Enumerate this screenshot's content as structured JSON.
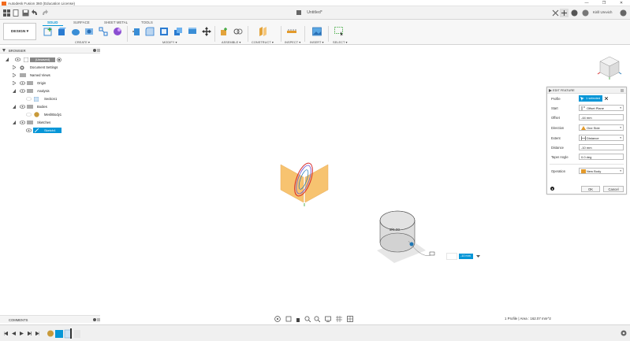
{
  "window": {
    "title": "Autodesk Fusion 360 (Education License)",
    "minimize": "—",
    "maximize": "❐",
    "close": "✕"
  },
  "appbar": {
    "document_title": "Untitled*",
    "user": "Kirill Urevich"
  },
  "toolbar": {
    "workspace": "DESIGN ▾",
    "tabs": [
      "SOLID",
      "SURFACE",
      "SHEET METAL",
      "TOOLS"
    ],
    "groups": [
      "CREATE ▾",
      "MODIFY ▾",
      "ASSEMBLE ▾",
      "CONSTRUCT ▾",
      "INSPECT ▾",
      "INSERT ▾",
      "SELECT ▾"
    ]
  },
  "browser": {
    "title": "BROWSER",
    "items": [
      {
        "label": "(Unsaved)",
        "depth": 0
      },
      {
        "label": "Document Settings",
        "depth": 1
      },
      {
        "label": "Named Views",
        "depth": 1
      },
      {
        "label": "Origin",
        "depth": 1
      },
      {
        "label": "Analysis",
        "depth": 1
      },
      {
        "label": "Section1",
        "depth": 2
      },
      {
        "label": "Bodies",
        "depth": 1
      },
      {
        "label": "MeshBody1",
        "depth": 2
      },
      {
        "label": "Sketches",
        "depth": 1
      },
      {
        "label": "Sketch4",
        "depth": 2
      }
    ]
  },
  "comments": {
    "title": "COMMENTS"
  },
  "status": {
    "text": "1 Profile | Area : 162.07 mm^2"
  },
  "viewport": {
    "dim_label": "Ø0.00",
    "value_input": "-10 mm"
  },
  "panel": {
    "title": "EDIT FEATURE",
    "profile_label": "Profile",
    "profile_value": "1 selected",
    "start_label": "Start",
    "start_value": "Offset Plane",
    "offset_label": "Offset",
    "offset_value": "-44 mm",
    "direction_label": "Direction",
    "direction_value": "One Side",
    "extent_label": "Extent",
    "extent_value": "Distance",
    "distance_label": "Distance",
    "distance_value": "-10 mm",
    "taper_label": "Taper Angle",
    "taper_value": "0.0 deg",
    "operation_label": "Operation",
    "operation_value": "New Body",
    "ok": "OK",
    "cancel": "Cancel"
  },
  "colors": {
    "accent": "#0696d7",
    "plane": "#f5b041",
    "toolbar_bg": "#f7f7f7"
  }
}
